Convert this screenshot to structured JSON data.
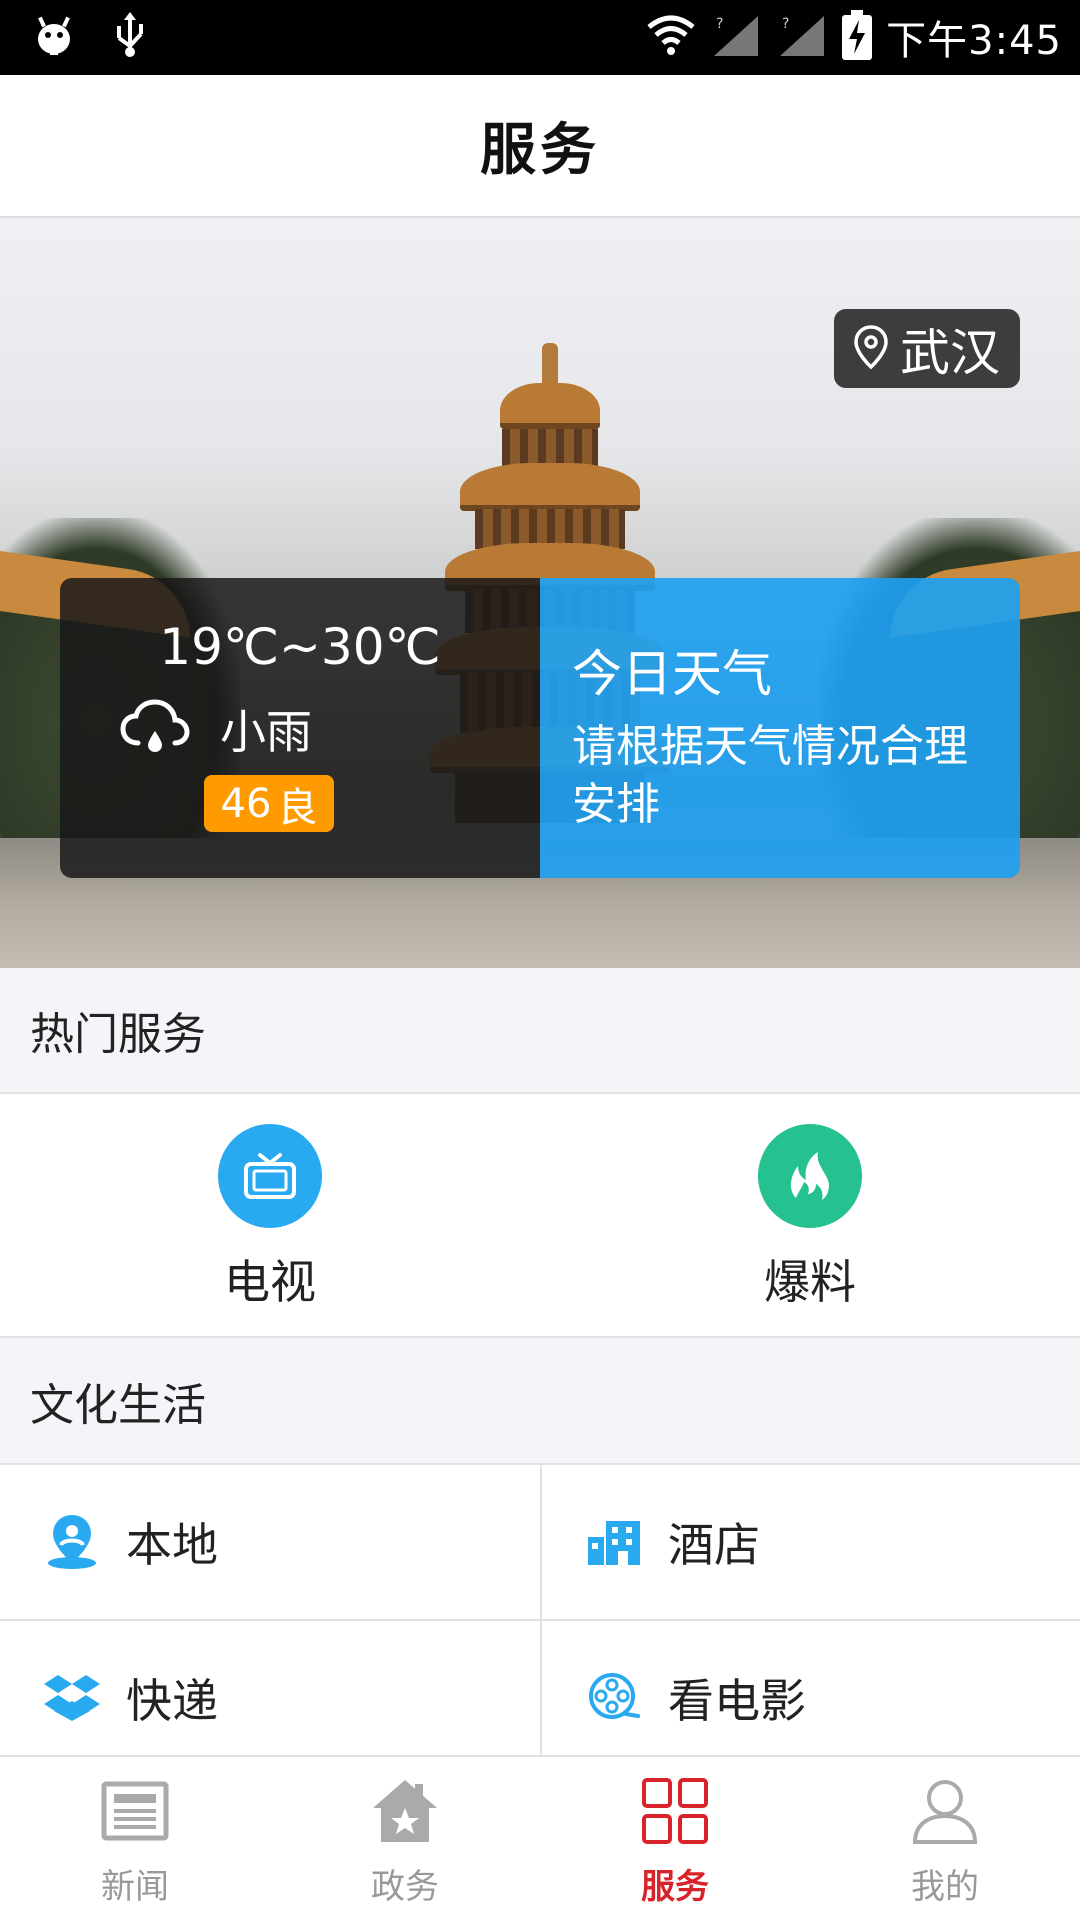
{
  "status_bar": {
    "time": "下午3:45"
  },
  "header": {
    "title": "服务"
  },
  "banner": {
    "location": "武汉",
    "weather": {
      "temperature": "19℃~30℃",
      "condition": "小雨",
      "aqi_value": "46",
      "aqi_level": "良",
      "today_title": "今日天气",
      "today_tip": "请根据天气情况合理安排"
    }
  },
  "hot_services": {
    "title": "热门服务",
    "items": [
      {
        "label": "电视",
        "icon": "tv-icon",
        "color": "#29aaf0"
      },
      {
        "label": "爆料",
        "icon": "flame-icon",
        "color": "#25c190"
      }
    ]
  },
  "culture_life": {
    "title": "文化生活",
    "items": [
      {
        "label": "本地",
        "icon": "location-pin-icon"
      },
      {
        "label": "酒店",
        "icon": "hotel-building-icon"
      },
      {
        "label": "快递",
        "icon": "package-box-icon"
      },
      {
        "label": "看电影",
        "icon": "film-reel-icon"
      }
    ]
  },
  "bottom_nav": {
    "items": [
      {
        "label": "新闻",
        "icon": "newspaper-icon",
        "active": false
      },
      {
        "label": "政务",
        "icon": "government-house-icon",
        "active": false
      },
      {
        "label": "服务",
        "icon": "grid-icon",
        "active": true
      },
      {
        "label": "我的",
        "icon": "profile-icon",
        "active": false
      }
    ]
  },
  "colors": {
    "accent_blue": "#29aaf0",
    "active_red": "#d9232a",
    "aqi_orange": "#ff9a00"
  }
}
